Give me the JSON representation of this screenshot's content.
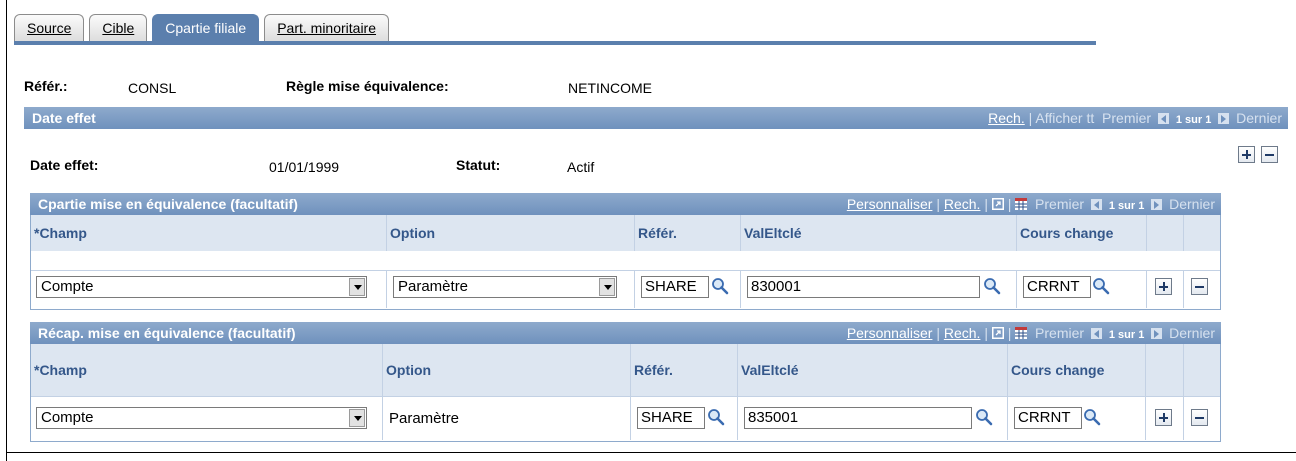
{
  "tabs": [
    {
      "label": "Source",
      "active": false
    },
    {
      "label": "Cible",
      "active": false
    },
    {
      "label": "Cpartie filiale",
      "active": true
    },
    {
      "label": "Part. minoritaire",
      "active": false
    }
  ],
  "header": {
    "refer_label": "Référ.:",
    "refer_value": "CONSL",
    "rule_label": "Règle mise équivalence:",
    "rule_value": "NETINCOME"
  },
  "effdate_bar": {
    "title": "Date effet",
    "nav": {
      "find": "Rech.",
      "sep": "|",
      "view_all": "Afficher tt",
      "first": "Premier",
      "position": "1 sur 1",
      "last": "Dernier"
    }
  },
  "effdate": {
    "date_label": "Date effet:",
    "date_value": "01/01/1999",
    "status_label": "Statut:",
    "status_value": "Actif"
  },
  "grid1": {
    "title": "Cpartie mise en équivalence (facultatif)",
    "nav": {
      "customize": "Personnaliser",
      "sep": "|",
      "find": "Rech.",
      "first": "Premier",
      "position": "1 sur 1",
      "last": "Dernier"
    },
    "columns": [
      "*Champ",
      "Option",
      "Référ.",
      "ValEltclé",
      "Cours change"
    ],
    "row": {
      "champ": "Compte",
      "option": "Paramètre",
      "refer": "SHARE",
      "valeltcle": "830001",
      "cours": "CRRNT"
    }
  },
  "grid2": {
    "title": "Récap. mise en équivalence (facultatif)",
    "nav": {
      "customize": "Personnaliser",
      "sep": "|",
      "find": "Rech.",
      "first": "Premier",
      "position": "1 sur 1",
      "last": "Dernier"
    },
    "columns": [
      "*Champ",
      "Option",
      "Référ.",
      "ValEltclé",
      "Cours change"
    ],
    "row": {
      "champ": "Compte",
      "option": "Paramètre",
      "refer": "SHARE",
      "valeltcle": "835001",
      "cours": "CRRNT"
    }
  },
  "icons": {
    "lookup": "magnifier-icon",
    "add": "plus-icon",
    "delete": "minus-icon",
    "zoom": "zoom-window-icon",
    "download": "spreadsheet-icon"
  },
  "colors": {
    "accent": "#5b7fad",
    "bar": "#7c9bc4",
    "header_text": "#34578a"
  }
}
